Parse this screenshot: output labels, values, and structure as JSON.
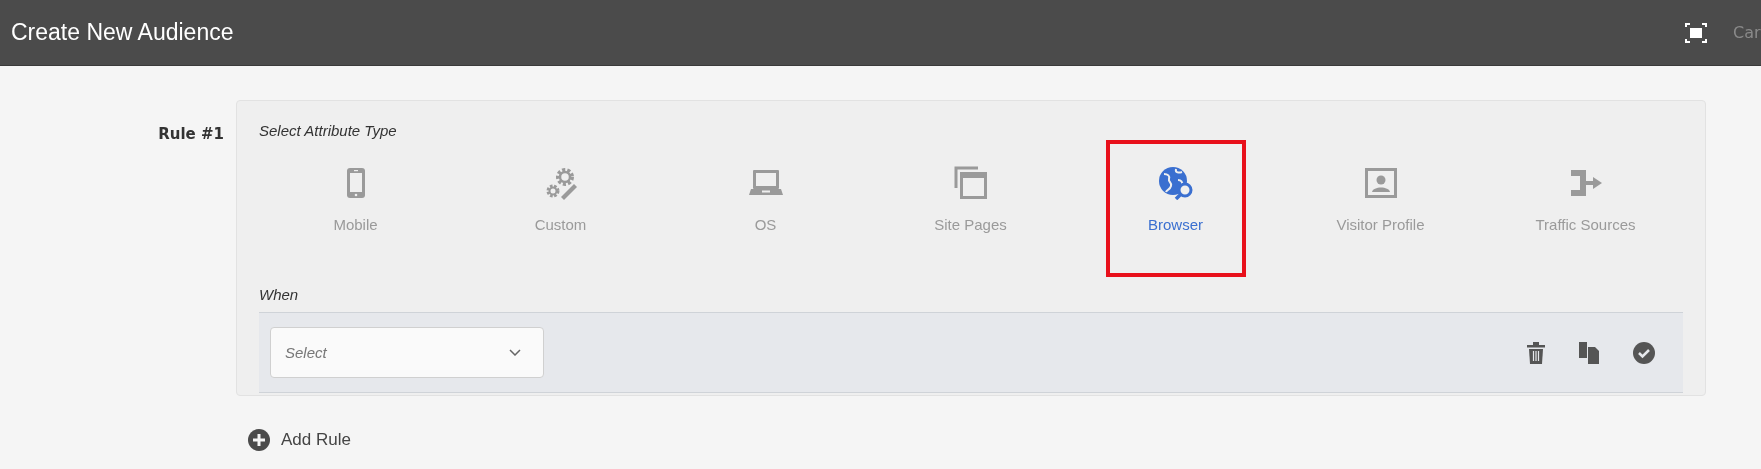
{
  "header": {
    "title": "Create New Audience",
    "cut_action": "Car"
  },
  "rule": {
    "label": "Rule #1",
    "section_title": "Select Attribute Type",
    "attribute_types": [
      {
        "label": "Mobile",
        "kind": "mobile",
        "selected": false
      },
      {
        "label": "Custom",
        "kind": "custom",
        "selected": false
      },
      {
        "label": "OS",
        "kind": "os",
        "selected": false
      },
      {
        "label": "Site Pages",
        "kind": "pages",
        "selected": false
      },
      {
        "label": "Browser",
        "kind": "browser",
        "selected": true
      },
      {
        "label": "Visitor Profile",
        "kind": "profile",
        "selected": false
      },
      {
        "label": "Traffic Sources",
        "kind": "traffic",
        "selected": false
      }
    ],
    "when_label": "When",
    "select": {
      "placeholder": "Select"
    }
  },
  "add_rule": "Add Rule"
}
